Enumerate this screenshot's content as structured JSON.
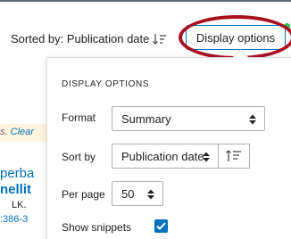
{
  "sort_bar": {
    "label": "Sorted by: Publication date"
  },
  "toolbar": {
    "display_options_label": "Display options"
  },
  "background_results": {
    "note_text": "s.",
    "note_link": "Clear",
    "title_line1": "perba",
    "title_line2": "nellit",
    "authors": "LK.",
    "citation": ":386-3"
  },
  "display_panel": {
    "heading": "DISPLAY OPTIONS",
    "format": {
      "label": "Format",
      "value": "Summary"
    },
    "sort_by": {
      "label": "Sort by",
      "value": "Publication date"
    },
    "per_page": {
      "label": "Per page",
      "value": "50"
    },
    "show_snippets": {
      "label": "Show snippets",
      "checked": true
    }
  },
  "colors": {
    "accent_blue": "#0071bc",
    "notification_dot": "#20c44a",
    "annotation_red": "#a80f1f",
    "top_rule": "#5b6770"
  },
  "icons": [
    "sort-descending-icon",
    "select-updown-icon",
    "sort-order-icon",
    "checkmark-icon",
    "notification-dot-icon"
  ]
}
